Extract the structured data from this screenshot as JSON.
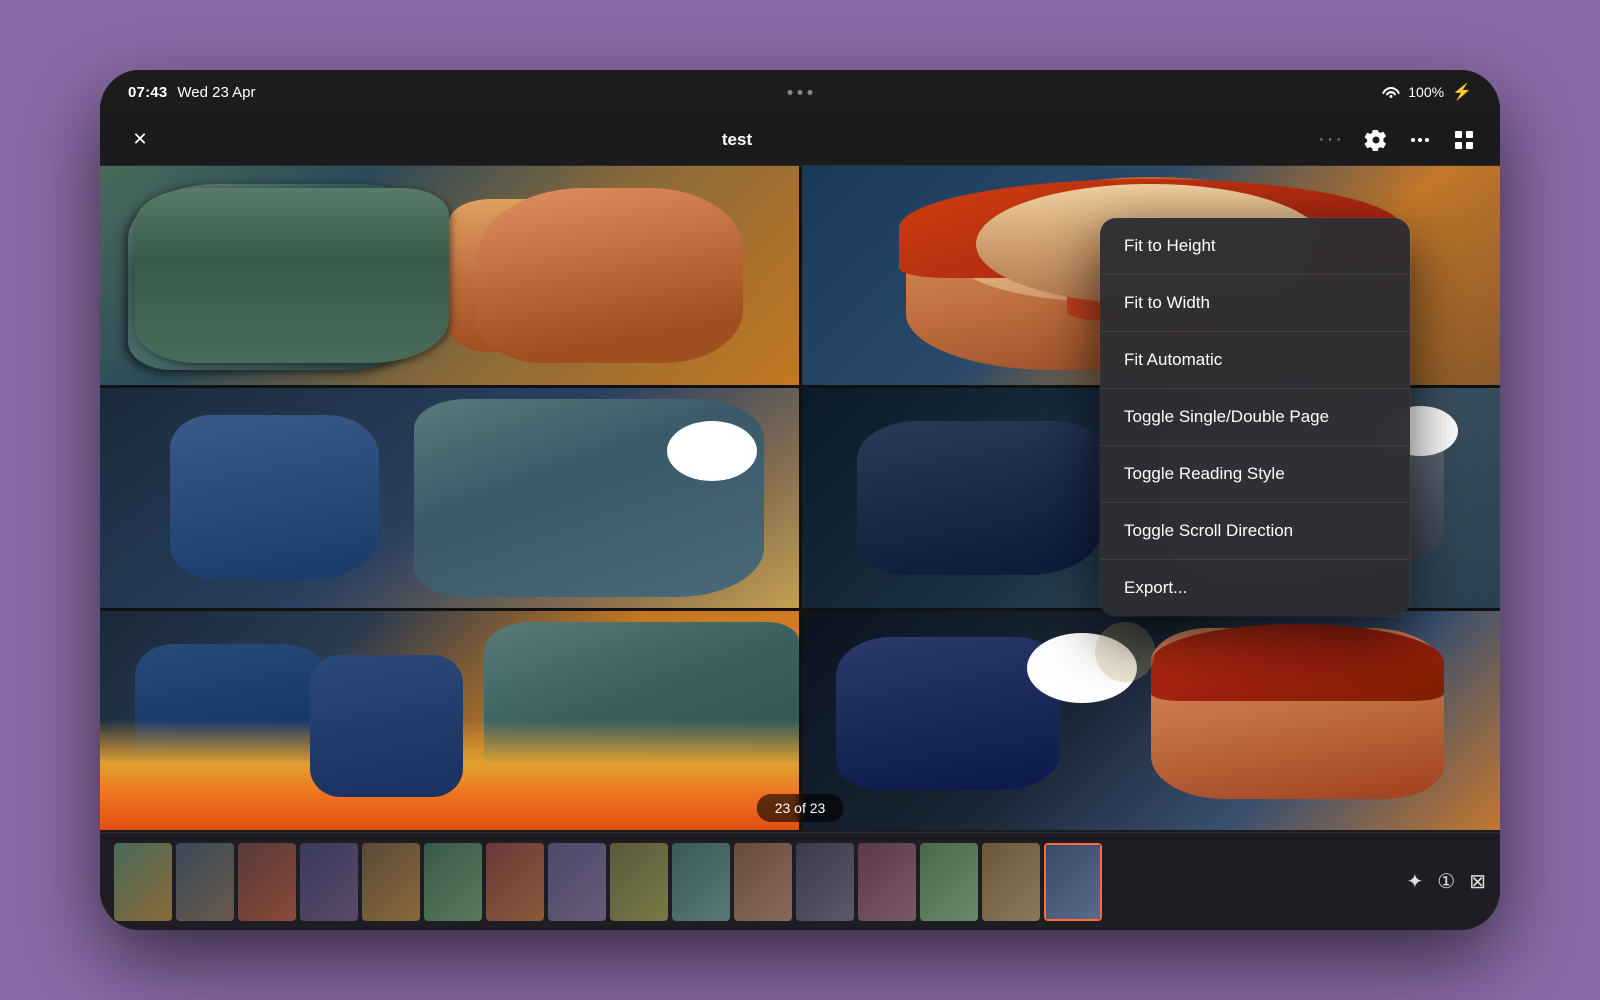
{
  "statusBar": {
    "time": "07:43",
    "date": "Wed 23 Apr",
    "wifi": "WiFi",
    "batteryPct": "100%",
    "batteryIcon": "🔋"
  },
  "navBar": {
    "closeLabel": "✕",
    "title": "test",
    "dotsLabel": "•••",
    "settingsIcon": "⚙",
    "shareIcon": "⋯",
    "gridIcon": "⊞"
  },
  "pageBadge": {
    "text": "23 of 23"
  },
  "dropdownMenu": {
    "items": [
      {
        "id": "fit-height",
        "label": "Fit to Height"
      },
      {
        "id": "fit-width",
        "label": "Fit to Width"
      },
      {
        "id": "fit-automatic",
        "label": "Fit Automatic"
      },
      {
        "id": "toggle-single-double",
        "label": "Toggle Single/Double Page"
      },
      {
        "id": "toggle-reading-style",
        "label": "Toggle Reading Style"
      },
      {
        "id": "toggle-scroll-direction",
        "label": "Toggle Scroll Direction"
      },
      {
        "id": "export",
        "label": "Export..."
      }
    ]
  },
  "thumbStrip": {
    "pages": [
      {
        "id": 1,
        "cls": "t1"
      },
      {
        "id": 2,
        "cls": "t2"
      },
      {
        "id": 3,
        "cls": "t3"
      },
      {
        "id": 4,
        "cls": "t4"
      },
      {
        "id": 5,
        "cls": "t5"
      },
      {
        "id": 6,
        "cls": "t6"
      },
      {
        "id": 7,
        "cls": "t7"
      },
      {
        "id": 8,
        "cls": "t8"
      },
      {
        "id": 9,
        "cls": "t9"
      },
      {
        "id": 10,
        "cls": "t10"
      },
      {
        "id": 11,
        "cls": "t11"
      },
      {
        "id": 12,
        "cls": "t12"
      },
      {
        "id": 13,
        "cls": "t13"
      },
      {
        "id": 14,
        "cls": "t14"
      },
      {
        "id": 15,
        "cls": "t15"
      },
      {
        "id": 16,
        "cls": "t16"
      }
    ],
    "actions": [
      {
        "id": "bookmark",
        "icon": "✦"
      },
      {
        "id": "page-num",
        "icon": "①"
      },
      {
        "id": "close",
        "icon": "⊠"
      }
    ]
  },
  "colors": {
    "accent": "#ff6b35",
    "background": "#8b6ba8",
    "surface": "#2d2d32",
    "text": "#ffffff"
  }
}
